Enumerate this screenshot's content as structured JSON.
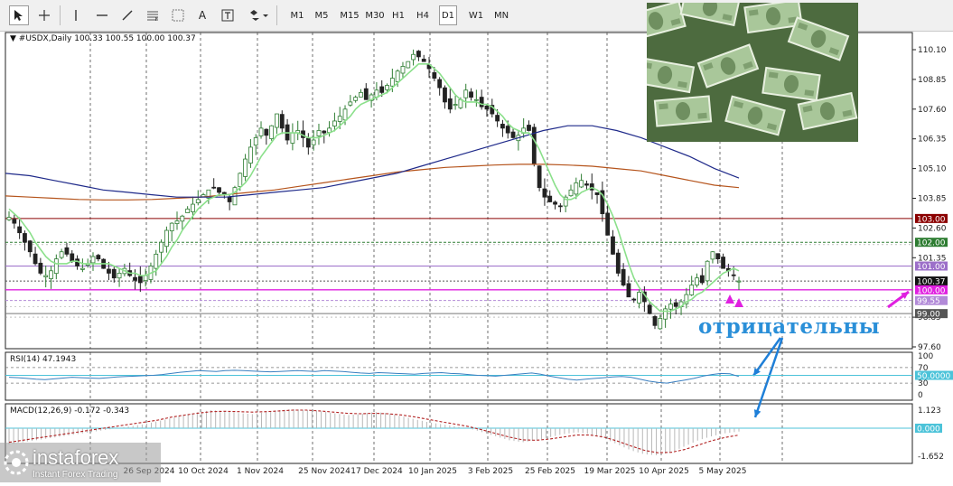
{
  "toolbar": {
    "tools": [
      "cursor-icon",
      "crosshair-icon",
      "vertical-line-icon",
      "horizontal-line-icon",
      "trendline-icon",
      "fibonacci-icon",
      "text-tool-icon",
      "text-label-icon",
      "shapes-icon"
    ],
    "text_tool_label": "A",
    "timeframes": [
      "M1",
      "M5",
      "M15",
      "M30",
      "H1",
      "H4",
      "D1",
      "W1",
      "MN"
    ],
    "active_timeframe": "D1"
  },
  "chart_header": {
    "symbol_line": "#USDX,Daily  100.33 100.55 100.00 100.37"
  },
  "annotation": "отрицательны",
  "logo": {
    "name": "instaforex",
    "tagline": "Instant Forex Trading"
  },
  "colors": {
    "bull": "#2e7d32",
    "bear": "#222222",
    "ma_fast": "#8be08b",
    "ma_mid": "#1f2a8a",
    "ma_slow": "#b5541c",
    "resistance": "#8b0000",
    "support_green": "#2e7d32",
    "level_violet": "#9c6fc9",
    "level_magenta": "#e020e0",
    "arrow_blue": "#1e7fd8",
    "arrow_magenta": "#e020e0",
    "rsi": "#3a7fc0",
    "macd_signal": "#b22222",
    "macd_hist": "#b8b8b8"
  },
  "chart_data": [
    {
      "type": "candlestick",
      "title": "#USDX,Daily",
      "ohlc_last": {
        "open": 100.33,
        "high": 100.55,
        "low": 100.0,
        "close": 100.37
      },
      "x_ticks": [
        "26 Sep 2024",
        "10 Oct 2024",
        "1 Nov 2024",
        "25 Nov 2024",
        "17 Dec 2024",
        "10 Jan 2025",
        "3 Feb 2025",
        "25 Feb 2025",
        "19 Mar 2025",
        "10 Apr 2025",
        "5 May 2025"
      ],
      "y_ticks": [
        "110.10",
        "108.85",
        "107.60",
        "106.35",
        "105.10",
        "103.85",
        "102.60",
        "101.35",
        "98.85",
        "97.60"
      ],
      "ylim": [
        97.0,
        110.8
      ],
      "closes": [
        103.05,
        102.8,
        102.4,
        102.0,
        101.6,
        101.1,
        100.7,
        100.6,
        100.8,
        101.3,
        101.6,
        101.5,
        101.2,
        101.0,
        100.9,
        101.1,
        101.4,
        101.3,
        100.9,
        100.7,
        100.5,
        100.7,
        100.9,
        100.6,
        100.4,
        100.3,
        100.6,
        101.0,
        101.5,
        102.0,
        102.5,
        102.8,
        102.9,
        103.1,
        103.4,
        103.6,
        103.8,
        104.0,
        104.2,
        104.3,
        104.1,
        104.0,
        103.7,
        104.3,
        104.9,
        105.5,
        106.0,
        106.4,
        106.8,
        106.5,
        106.9,
        107.4,
        106.8,
        106.3,
        106.6,
        106.7,
        106.4,
        106.0,
        106.3,
        106.7,
        106.6,
        106.8,
        107.1,
        107.3,
        107.6,
        107.9,
        108.1,
        108.3,
        108.0,
        108.2,
        108.4,
        108.3,
        108.6,
        108.9,
        109.2,
        109.4,
        109.6,
        109.9,
        109.8,
        109.6,
        109.3,
        108.9,
        108.5,
        107.9,
        107.6,
        107.8,
        108.0,
        108.4,
        108.1,
        108.0,
        107.7,
        107.6,
        107.4,
        107.1,
        106.8,
        106.6,
        106.4,
        106.5,
        106.8,
        106.7,
        105.3,
        104.3,
        103.9,
        103.7,
        103.6,
        103.5,
        103.9,
        104.2,
        104.5,
        104.6,
        104.4,
        104.2,
        104.0,
        103.2,
        102.3,
        101.5,
        100.7,
        100.2,
        99.7,
        99.6,
        99.9,
        99.5,
        99.0,
        98.5,
        98.8,
        99.2,
        99.4,
        99.3,
        99.5,
        99.8,
        100.2,
        100.5,
        100.3,
        101.2,
        101.6,
        101.3,
        100.9,
        100.8,
        100.6,
        100.37
      ],
      "series": [
        {
          "name": "MA fast",
          "values": [
            103.4,
            103.2,
            103.0,
            102.7,
            102.4,
            102.0,
            101.7,
            101.4,
            101.2,
            101.1,
            101.1,
            101.1,
            101.2,
            101.2,
            101.1,
            101.1,
            101.1,
            101.1,
            101.1,
            101.1,
            101.0,
            100.9,
            100.8,
            100.7,
            100.7,
            100.6,
            100.6,
            100.7,
            100.8,
            101.1,
            101.4,
            101.8,
            102.1,
            102.5,
            102.8,
            103.1,
            103.4,
            103.6,
            103.8,
            103.9,
            104.0,
            104.0,
            104.0,
            104.1,
            104.3,
            104.5,
            104.8,
            105.2,
            105.6,
            105.9,
            106.2,
            106.5,
            106.6,
            106.6,
            106.6,
            106.6,
            106.5,
            106.4,
            106.4,
            106.4,
            106.5,
            106.6,
            106.7,
            106.9,
            107.1,
            107.3,
            107.6,
            107.8,
            107.9,
            108.0,
            108.1,
            108.2,
            108.3,
            108.5,
            108.7,
            108.9,
            109.1,
            109.3,
            109.5,
            109.5,
            109.5,
            109.3,
            109.1,
            108.8,
            108.5,
            108.2,
            108.0,
            107.9,
            107.9,
            107.9,
            107.8,
            107.8,
            107.7,
            107.5,
            107.3,
            107.0,
            106.8,
            106.7,
            106.6,
            106.6,
            106.3,
            105.9,
            105.4,
            104.9,
            104.4,
            104.0,
            103.8,
            103.8,
            103.9,
            104.1,
            104.2,
            104.3,
            104.2,
            104.0,
            103.6,
            103.1,
            102.5,
            101.8,
            101.1,
            100.5,
            100.1,
            99.8,
            99.5,
            99.3,
            99.1,
            99.1,
            99.1,
            99.2,
            99.3,
            99.5,
            99.6,
            99.8,
            99.9,
            100.1,
            100.3,
            100.5,
            100.7,
            100.8,
            100.9,
            100.8
          ]
        },
        {
          "name": "MA mid",
          "values": [
            104.9,
            104.8,
            104.6,
            104.4,
            104.2,
            104.1,
            104.0,
            103.9,
            103.9,
            103.9,
            104.0,
            104.1,
            104.2,
            104.3,
            104.5,
            104.7,
            104.9,
            105.2,
            105.5,
            105.8,
            106.1,
            106.4,
            106.7,
            106.9,
            106.9,
            106.7,
            106.4,
            106.0,
            105.6,
            105.1,
            104.7
          ]
        },
        {
          "name": "MA slow",
          "values": [
            103.95,
            103.9,
            103.85,
            103.8,
            103.78,
            103.78,
            103.8,
            103.85,
            103.9,
            104.0,
            104.1,
            104.2,
            104.35,
            104.5,
            104.65,
            104.8,
            104.95,
            105.05,
            105.15,
            105.2,
            105.25,
            105.28,
            105.28,
            105.25,
            105.2,
            105.1,
            105.0,
            104.8,
            104.6,
            104.4,
            104.3
          ]
        }
      ],
      "levels": [
        {
          "label": "103.00",
          "value": 103.0,
          "kind": "resistance"
        },
        {
          "label": "102.00",
          "value": 102.0,
          "kind": "support_green"
        },
        {
          "label": "101.00",
          "value": 101.0,
          "kind": "level_violet"
        },
        {
          "label": "100.37",
          "value": 100.37,
          "kind": "current"
        },
        {
          "label": "100.00",
          "value": 100.0,
          "kind": "level_magenta"
        },
        {
          "label": "99.55",
          "value": 99.55,
          "kind": "level_violet_light"
        },
        {
          "label": "99.00",
          "value": 99.0,
          "kind": "level_gray"
        }
      ]
    },
    {
      "type": "line",
      "title": "RSI(14) 47.1943",
      "y_ticks": [
        "100",
        "70",
        "30",
        "0"
      ],
      "ylim": [
        0,
        100
      ],
      "level_label": "50.0000",
      "values": [
        45,
        44,
        42,
        40,
        39,
        41,
        43,
        45,
        44,
        43,
        42,
        44,
        46,
        47,
        48,
        49,
        50,
        52,
        55,
        58,
        60,
        62,
        61,
        60,
        62,
        63,
        62,
        61,
        60,
        59,
        60,
        61,
        62,
        61,
        60,
        62,
        61,
        60,
        58,
        56,
        55,
        57,
        56,
        55,
        54,
        53,
        55,
        56,
        57,
        55,
        54,
        52,
        50,
        49,
        48,
        50,
        52,
        54,
        56,
        53,
        48,
        44,
        40,
        38,
        40,
        42,
        44,
        46,
        47,
        45,
        40,
        35,
        32,
        30,
        34,
        38,
        42,
        48,
        52,
        55,
        54,
        47
      ]
    },
    {
      "type": "bar",
      "title": "MACD(12,26,9) -0.172 -0.343",
      "y_ticks": [
        "1.123",
        "-1.652"
      ],
      "ylim": [
        -1.652,
        1.123
      ],
      "zero_label": "0.000",
      "hist": [
        -0.8,
        -0.7,
        -0.6,
        -0.5,
        -0.4,
        -0.3,
        -0.2,
        -0.1,
        0.0,
        0.1,
        0.2,
        0.35,
        0.5,
        0.65,
        0.8,
        0.9,
        0.85,
        0.75,
        0.7,
        0.8,
        0.9,
        0.95,
        0.9,
        0.85,
        0.75,
        0.65,
        0.7,
        0.8,
        0.75,
        0.6,
        0.45,
        0.3,
        0.2,
        0.1,
        0.0,
        -0.2,
        -0.4,
        -0.6,
        -0.7,
        -0.6,
        -0.45,
        -0.3,
        -0.2,
        -0.3,
        -0.5,
        -0.8,
        -1.1,
        -1.3,
        -1.35,
        -1.2,
        -0.9,
        -0.6,
        -0.4,
        -0.25,
        -0.17
      ],
      "signal": [
        -0.7,
        -0.6,
        -0.5,
        -0.4,
        -0.3,
        -0.2,
        -0.1,
        0.0,
        0.1,
        0.2,
        0.3,
        0.4,
        0.55,
        0.65,
        0.75,
        0.82,
        0.84,
        0.82,
        0.8,
        0.82,
        0.86,
        0.9,
        0.9,
        0.86,
        0.8,
        0.74,
        0.72,
        0.74,
        0.72,
        0.66,
        0.56,
        0.44,
        0.32,
        0.2,
        0.08,
        -0.08,
        -0.26,
        -0.44,
        -0.58,
        -0.6,
        -0.54,
        -0.44,
        -0.34,
        -0.34,
        -0.44,
        -0.64,
        -0.88,
        -1.1,
        -1.22,
        -1.2,
        -1.06,
        -0.84,
        -0.62,
        -0.46,
        -0.34
      ]
    }
  ]
}
